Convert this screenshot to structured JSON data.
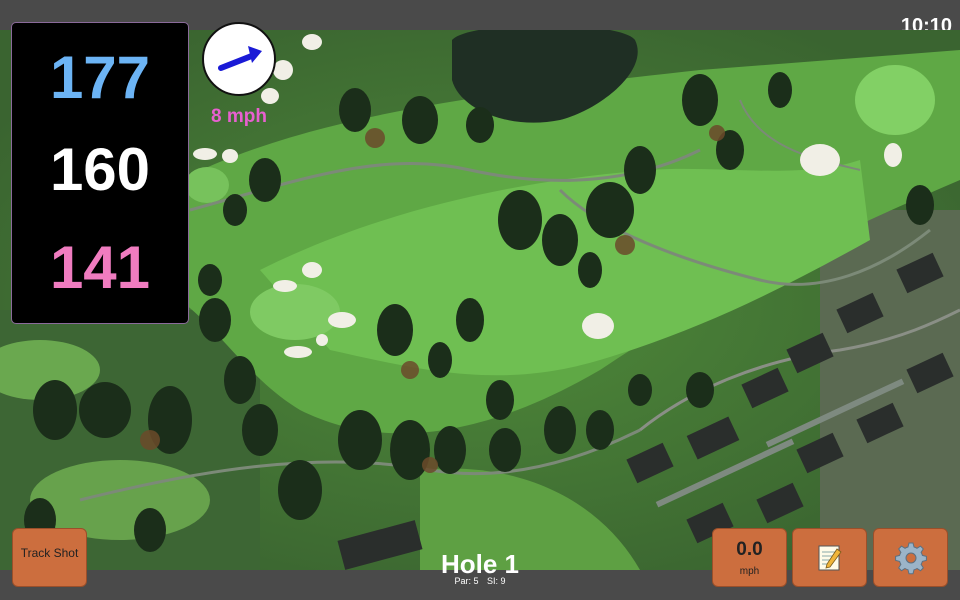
{
  "status_bar": {
    "time": "10:10"
  },
  "yardages": {
    "back": "177",
    "middle": "160",
    "front": "141"
  },
  "wind": {
    "speed_label": "8 mph",
    "icon": "wind-arrow-icon"
  },
  "hole": {
    "title": "Hole 1",
    "par": "Par: 5",
    "si": "SI: 9"
  },
  "buttons": {
    "track_shot": "Track Shot",
    "wind_value": "0.0",
    "wind_unit": "mph",
    "notes_icon": "notepad-icon",
    "settings_icon": "gear-icon"
  },
  "colors": {
    "back_yardage": "#6cb4f5",
    "middle_yardage": "#ffffff",
    "front_yardage": "#f07cc0",
    "wind_text": "#e860d0",
    "button": "#cc6e3e",
    "divider": "#cc66cc"
  }
}
